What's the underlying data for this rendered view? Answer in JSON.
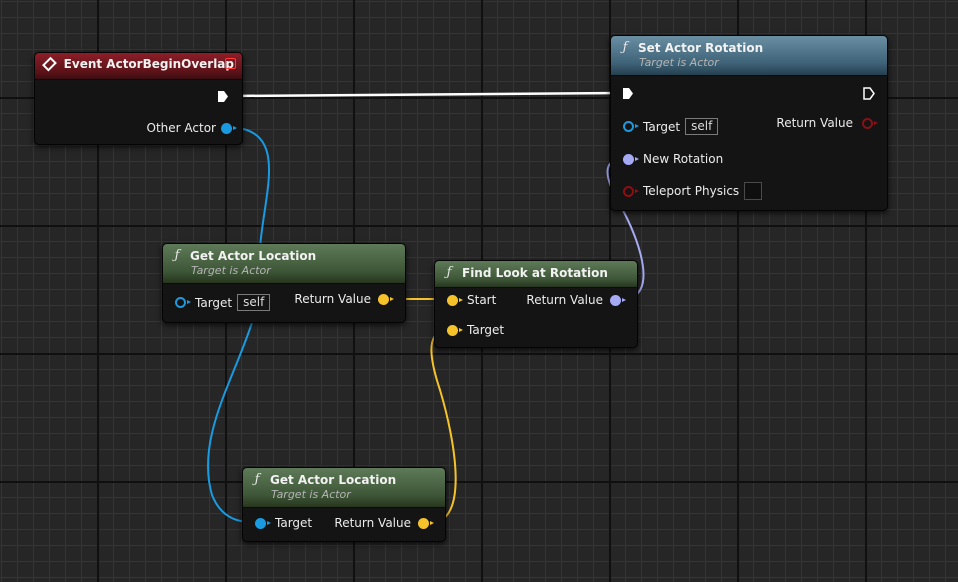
{
  "nodes": {
    "event_overlap": {
      "title": "Event ActorBeginOverlap",
      "pin_other_actor": "Other Actor"
    },
    "set_actor_rotation": {
      "title": "Set Actor Rotation",
      "subtitle": "Target is Actor",
      "pin_target": "Target",
      "target_default": "self",
      "pin_return": "Return Value",
      "pin_new_rotation": "New Rotation",
      "pin_teleport": "Teleport Physics"
    },
    "get_actor_location_1": {
      "title": "Get Actor Location",
      "subtitle": "Target is Actor",
      "pin_target": "Target",
      "target_default": "self",
      "pin_return": "Return Value"
    },
    "find_look_at_rotation": {
      "title": "Find Look at Rotation",
      "pin_start": "Start",
      "pin_target": "Target",
      "pin_return": "Return Value"
    },
    "get_actor_location_2": {
      "title": "Get Actor Location",
      "subtitle": "Target is Actor",
      "pin_target": "Target",
      "pin_return": "Return Value"
    }
  },
  "colors": {
    "object_pin": "#1a9ae0",
    "vector_pin": "#f6c22a",
    "rotator_pin": "#a5aaf2",
    "bool_pin": "#8c0f16",
    "exec_wire": "#ffffff",
    "event_header": "#8c1e28",
    "pure_func_header": "#3d5637",
    "func_header": "#3e6277"
  },
  "icons": {
    "event": "event-diamond-icon",
    "function": "function-f-icon",
    "close": "close-square-icon"
  }
}
